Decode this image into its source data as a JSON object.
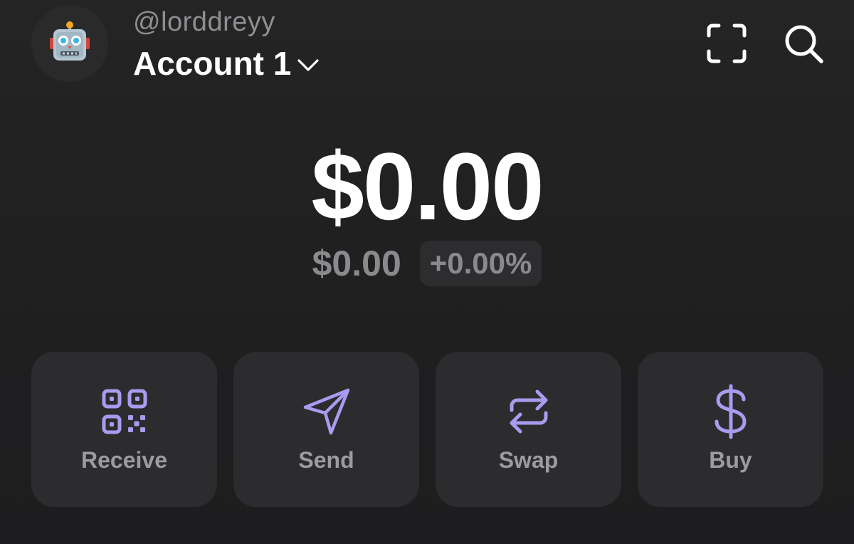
{
  "header": {
    "avatar_icon": "robot-emoji-icon",
    "username": "@lorddreyy",
    "account_name": "Account 1",
    "icons": [
      "scan-icon",
      "search-icon"
    ]
  },
  "balance": {
    "total": "$0.00",
    "change_value": "$0.00",
    "change_percent": "+0.00%"
  },
  "actions": [
    {
      "label": "Receive",
      "icon": "qr-code-icon"
    },
    {
      "label": "Send",
      "icon": "send-icon"
    },
    {
      "label": "Swap",
      "icon": "swap-icon"
    },
    {
      "label": "Buy",
      "icon": "dollar-icon"
    }
  ],
  "colors": {
    "accent": "#a89cf0",
    "background": "#222222",
    "card": "#2c2c2e",
    "muted_text": "#8a8a8e"
  }
}
